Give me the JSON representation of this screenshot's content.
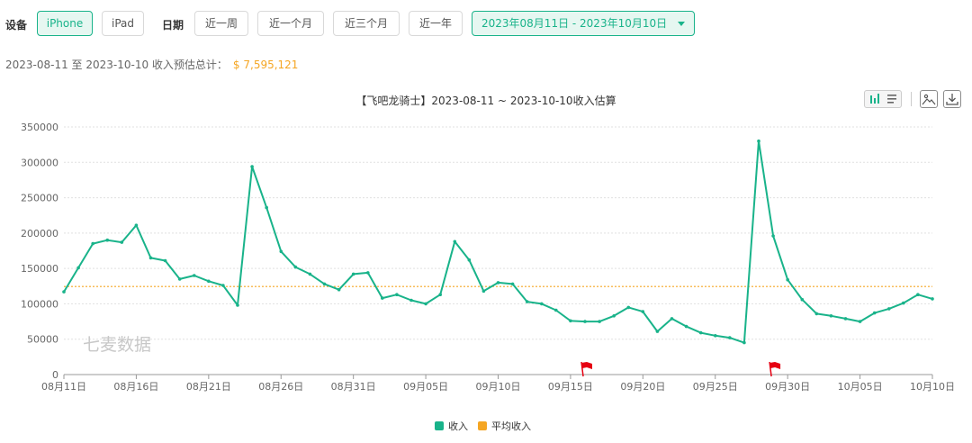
{
  "filters": {
    "device_label": "设备",
    "devices": [
      {
        "label": "iPhone",
        "active": true
      },
      {
        "label": "iPad",
        "active": false
      }
    ],
    "date_label": "日期",
    "quick_ranges": [
      "近一周",
      "近一个月",
      "近三个月",
      "近一年"
    ],
    "date_range": "2023年08月11日 - 2023年10月10日"
  },
  "summary": {
    "text": "2023-08-11 至 2023-10-10 收入预估总计：",
    "total": "$ 7,595,121"
  },
  "colors": {
    "accent": "#19b38a",
    "income_line": "#19b38a",
    "average_line": "#f5a623",
    "flag": "#e60012"
  },
  "toolbar_icons": [
    "bar-chart-icon",
    "list-icon",
    "image-icon",
    "download-icon"
  ],
  "legend": [
    {
      "name": "收入",
      "color": "#19b38a"
    },
    {
      "name": "平均收入",
      "color": "#f5a623"
    }
  ],
  "watermark": "七麦数据",
  "chart_data": {
    "type": "line",
    "title": "【飞吧龙骑士】2023-08-11 ~ 2023-10-10收入估算",
    "xlabel": "",
    "ylabel": "",
    "ylim": [
      0,
      350000
    ],
    "yticks": [
      0,
      50000,
      100000,
      150000,
      200000,
      250000,
      300000,
      350000
    ],
    "x_tick_labels": [
      "08月11日",
      "08月16日",
      "08月21日",
      "08月26日",
      "08月31日",
      "09月05日",
      "09月10日",
      "09月15日",
      "09月20日",
      "09月25日",
      "09月30日",
      "10月05日",
      "10月10日"
    ],
    "grid": true,
    "legend_position": "bottom",
    "x_start": "2023-08-11",
    "x_end": "2023-10-10",
    "series": [
      {
        "name": "收入",
        "values": [
          117000,
          151000,
          185000,
          190000,
          187000,
          211000,
          165000,
          161000,
          135000,
          140000,
          132000,
          126000,
          98000,
          294000,
          236000,
          174000,
          152000,
          142000,
          128000,
          120000,
          142000,
          144000,
          108000,
          113000,
          105000,
          100000,
          113000,
          188000,
          162000,
          118000,
          130000,
          128000,
          103000,
          100000,
          91000,
          76000,
          75000,
          75000,
          83000,
          95000,
          89000,
          61000,
          79000,
          68000,
          59000,
          55000,
          52000,
          45000,
          330000,
          196000,
          134000,
          106000,
          86000,
          83000,
          79000,
          75000,
          87000,
          93000,
          101000,
          113000,
          107000
        ]
      },
      {
        "name": "平均收入",
        "value": 124510
      }
    ],
    "flag_markers": [
      "2023-09-16",
      "2023-09-29"
    ]
  }
}
